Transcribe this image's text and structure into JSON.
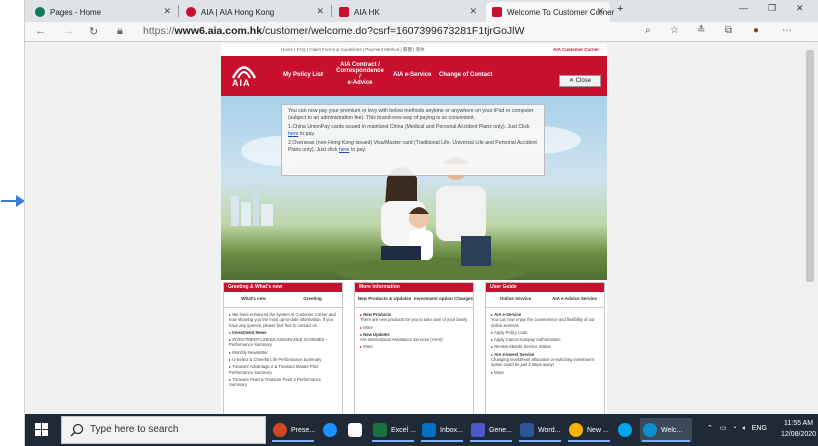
{
  "browser": {
    "tabs": [
      {
        "title": "Pages - Home",
        "fav_color": "#0b7a5b"
      },
      {
        "title": "AIA | AIA Hong Kong",
        "fav_color": "#c8102e"
      },
      {
        "title": "AIA HK",
        "fav_color": "#c8102e"
      },
      {
        "title": "Welcome To Customer Corner",
        "fav_color": "#c8102e",
        "active": true
      }
    ],
    "new_tab": "+",
    "url_prefix": "https://",
    "url_host": "www6.aia.com.hk",
    "url_path": "/customer/welcome.do?csrf=1607399673281F1tjrGoJlW",
    "win_min": "—",
    "win_max": "❐",
    "win_close": "✕"
  },
  "page": {
    "top_links": "Home  |  FAQ  |  Claim Forms & Guidelines  |  Payment Method  |  繁體  |  简体",
    "customer_corner": "AIA Customer Corner",
    "logo_text": "AIA",
    "menu": {
      "my_policy": "My Policy List",
      "contract_l1": "AIA Contract /",
      "contract_l2": "Correspondence /",
      "contract_l3": "e-Advice",
      "eservice": "AIA e-Service",
      "change_contact": "Change of Contact"
    },
    "close_label": "✕  Close",
    "notice": {
      "intro": "You can now pay your premium or levy with below methods anytime or anywhere on your iPad or computer (subject to an administration fee). This brand-new way of paying is so convenient.",
      "item1_pre": "1.China UnionPay cards issued in mainland China (Medical and Personal Accident Plans only). Just Click ",
      "item1_link": "here",
      "item1_post": " to pay.",
      "item2_pre": "2.Overseas (non-Hong Kong issued) Visa/Master card (Traditional Life, Universal Life and Personal Accident Plans only). Just click ",
      "item2_link": "here",
      "item2_post": " to pay."
    },
    "box1": {
      "title": "Greeting & What's new",
      "tab1": "What's new",
      "tab2": "Greeting",
      "items": [
        "We have enhanced the system of Customer Corner and now showing you the most up-to-date information. If you have any queries, please feel free to contact us.",
        "Investment News",
        "INVESTMENT-LINKED ASSURANCE SCHEMES - Performance Summary",
        "Monthly Newsletter",
        "U-Select & Cheerful Life Performance Summary",
        "Treasure Advantage 2 & Treasure Master Plus Performance Summary",
        "Treasure Pearl & Treasure Pearl 2 Performance Summary"
      ]
    },
    "box2": {
      "title": "More Information",
      "tab1": "New Products & Updates",
      "tab2": "Investment option Changes",
      "items": [
        "New Products",
        "There are new products for you to take care of your family",
        "More",
        "New Updates",
        "AIA International Assistance Services (AIAS)",
        "More"
      ]
    },
    "box3": {
      "title": "User Guide",
      "tab1": "Online Service",
      "tab2": "AIA e-Advice Service",
      "items": [
        "AIA e-Service",
        "You can now enjoy the convenience and flexibility of our online services",
        "Apply Policy Loan",
        "Apply Cancel Autopay Authorization",
        "Review eBankr Service Status",
        "AIA e-Invest Service",
        "Changing investment allocation or switching investment option could be just 3 steps away!",
        "More"
      ]
    }
  },
  "taskbar": {
    "search_placeholder": "Type here to search",
    "apps": [
      {
        "label": "Prese...",
        "color": "#d24726"
      },
      {
        "label": "",
        "color": "#1e90ff"
      },
      {
        "label": "",
        "color": "#ffffff"
      },
      {
        "label": "Excel ...",
        "color": "#1d6f42"
      },
      {
        "label": "Inbox...",
        "color": "#0072c6"
      },
      {
        "label": "Gene...",
        "color": "#5059c9"
      },
      {
        "label": "Word...",
        "color": "#2b579a"
      },
      {
        "label": "New ...",
        "color": "#f4b400"
      },
      {
        "label": "",
        "color": "#00a4ef"
      },
      {
        "label": "Welc...",
        "color": "#0f8fd0"
      }
    ],
    "tray_lang": "ENG",
    "time": "11:55 AM",
    "date": "12/08/2020"
  }
}
